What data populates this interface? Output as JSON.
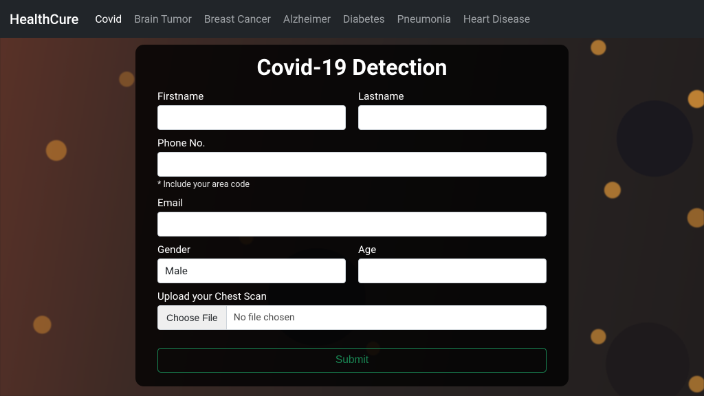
{
  "brand": "HealthCure",
  "nav": {
    "items": [
      "Covid",
      "Brain Tumor",
      "Breast Cancer",
      "Alzheimer",
      "Diabetes",
      "Pneumonia",
      "Heart Disease"
    ],
    "active": "Covid"
  },
  "form": {
    "title": "Covid-19 Detection",
    "firstname_label": "Firstname",
    "firstname_value": "",
    "lastname_label": "Lastname",
    "lastname_value": "",
    "phone_label": "Phone No.",
    "phone_value": "",
    "phone_hint": "* Include your area code",
    "email_label": "Email",
    "email_value": "",
    "gender_label": "Gender",
    "gender_value": "Male",
    "age_label": "Age",
    "age_value": "",
    "upload_label": "Upload your Chest Scan",
    "choose_file_label": "Choose File",
    "file_status": "No file chosen",
    "submit_label": "Submit"
  }
}
